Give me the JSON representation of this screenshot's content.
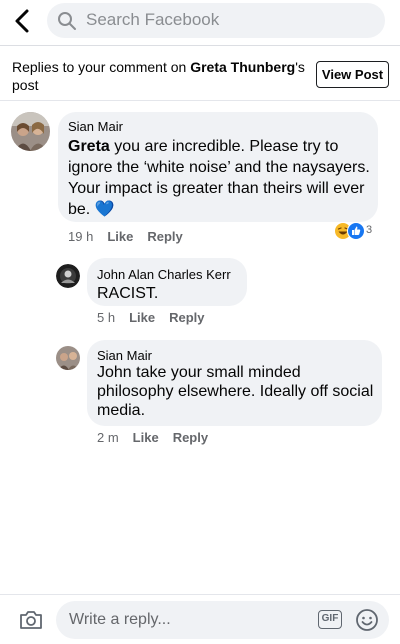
{
  "search": {
    "placeholder": "Search Facebook"
  },
  "header": {
    "prefix": "Replies to your comment on ",
    "name": "Greta Thunberg",
    "suffix": "'s post",
    "view_post_label": "View Post"
  },
  "comments": [
    {
      "author": "Sian Mair",
      "mention": "Greta",
      "text": " you are incredible. Please try to ignore the ‘white noise’ and the naysayers. Your impact is greater than theirs will ever be.",
      "emoji": "💙",
      "time": "19 h",
      "like_label": "Like",
      "reply_label": "Reply",
      "reaction_count": "3",
      "reactions": [
        "laugh-react-icon",
        "like-react-icon"
      ]
    },
    {
      "author": "John Alan Charles Kerr",
      "text": "RACIST.",
      "time": "5 h",
      "like_label": "Like",
      "reply_label": "Reply"
    },
    {
      "author": "Sian Mair",
      "text": "John take your small minded philosophy elsewhere. Ideally off social media.",
      "time": "2 m",
      "like_label": "Like",
      "reply_label": "Reply"
    }
  ],
  "composer": {
    "placeholder": "Write a reply...",
    "gif_label": "GIF"
  },
  "colors": {
    "bubble": "#f0f2f5",
    "reaction_like": "#1877f2",
    "reaction_laugh": "#f7b928",
    "heart": "#3b8df0"
  }
}
